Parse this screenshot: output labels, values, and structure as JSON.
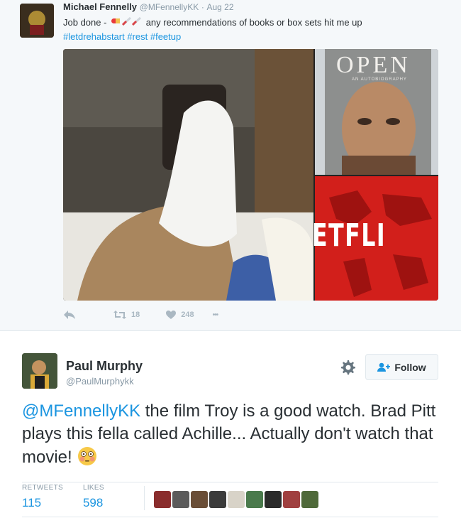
{
  "quoted_tweet": {
    "author_name": "Michael Fennelly",
    "handle": "@MFennellyKK",
    "separator": "·",
    "date": "Aug 22",
    "text_before_emoji": "Job done -",
    "text_after_emoji": "any recommendations of books or box sets hit me up",
    "hashtags": "#letdrehabstart #rest #feetup",
    "book_title": "OPEN",
    "book_subtitle": "AN AUTOBIOGRAPHY",
    "netflix_text": "ETFLI",
    "retweet_count": "18",
    "like_count": "248",
    "more_label": "•••"
  },
  "tweet": {
    "author_name": "Paul Murphy",
    "handle": "@PaulMurphykk",
    "follow_label": "Follow",
    "mention": "@MFennellyKK",
    "text_rest": " the film Troy is a good watch. Brad Pitt plays this fella called Achille... Actually don't watch that movie!",
    "stats": [
      {
        "label": "RETWEETS",
        "value": "115"
      },
      {
        "label": "LIKES",
        "value": "598"
      }
    ],
    "liker_colors": [
      "#8a2d2d",
      "#5b5b5b",
      "#6a4e37",
      "#3b3b3b",
      "#d8d3c8",
      "#4a7a4c",
      "#2b2b2b",
      "#a04040",
      "#4f6a3a"
    ]
  },
  "colors": {
    "link": "#1b95e0",
    "muted": "#8899a6",
    "action": "#aab8c2",
    "netflix_red": "#d21f1b"
  },
  "icons": [
    "reply-icon",
    "retweet-icon",
    "heart-icon",
    "more-icon",
    "gear-icon",
    "follow-person-icon",
    "flushed-face-emoji"
  ]
}
